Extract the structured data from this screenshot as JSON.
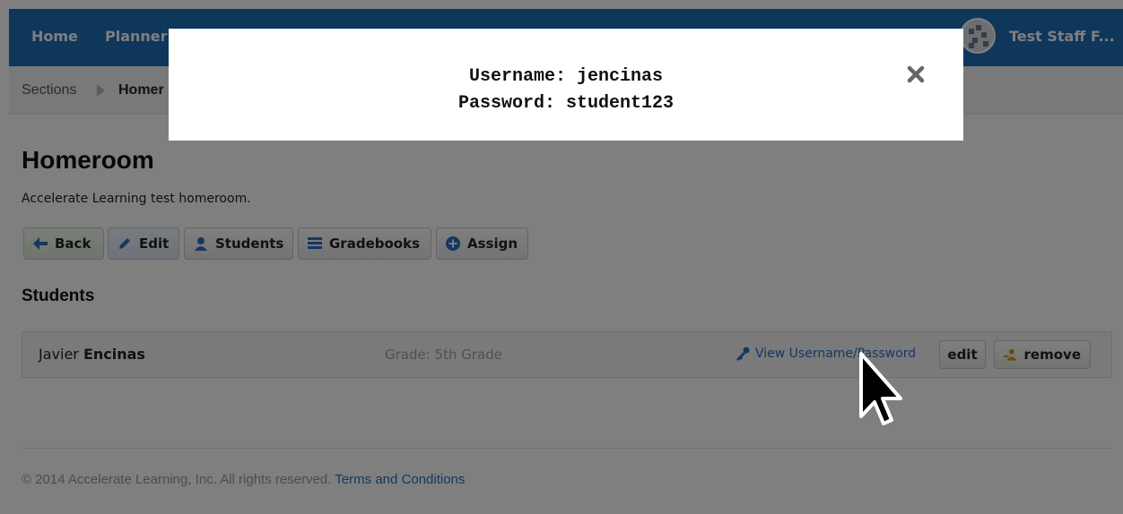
{
  "nav": {
    "items": [
      {
        "label": "Home"
      },
      {
        "label": "Planner"
      }
    ],
    "user_name": "Test Staff F..."
  },
  "breadcrumb": {
    "items": [
      {
        "label": "Sections"
      },
      {
        "label": "Homer"
      }
    ]
  },
  "page": {
    "title": "Homeroom",
    "description": "Accelerate Learning test homeroom.",
    "buttons": {
      "back": "Back",
      "edit": "Edit",
      "students": "Students",
      "gradebooks": "Gradebooks",
      "assign": "Assign"
    }
  },
  "students": {
    "title": "Students",
    "rows": [
      {
        "first_name": "Javier",
        "last_name": "Encinas",
        "grade": "Grade: 5th Grade",
        "view_link": "View Username/Password",
        "edit_label": "edit",
        "remove_label": "remove"
      }
    ]
  },
  "footer": {
    "copyright": "© 2014 Accelerate Learning, Inc. All rights reserved.",
    "terms_link": "Terms and Conditions"
  },
  "modal": {
    "username_line": "Username: jencinas",
    "password_line": "Password: student123"
  },
  "colors": {
    "nav_bg": "#1f6db6",
    "link": "#2a6fc0",
    "overlay": "rgba(0,0,0,0.5)"
  }
}
